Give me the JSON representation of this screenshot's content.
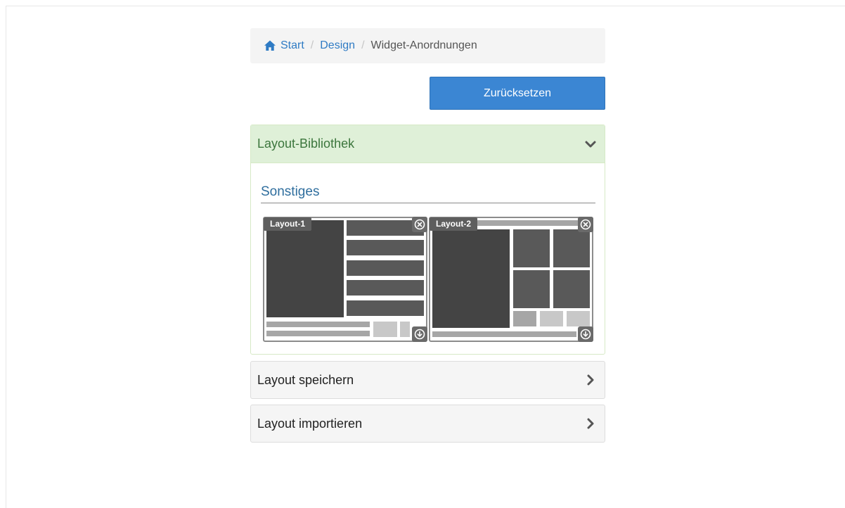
{
  "breadcrumb": {
    "items": [
      {
        "label": "Start",
        "icon": "home-icon",
        "link": true
      },
      {
        "label": "Design",
        "link": true
      },
      {
        "label": "Widget-Anordnungen",
        "link": false
      }
    ],
    "separator": "/"
  },
  "toolbar": {
    "reset_label": "Zurücksetzen"
  },
  "library": {
    "title": "Layout-Bibliothek",
    "section_title": "Sonstiges",
    "layouts": [
      {
        "label": "Layout-1"
      },
      {
        "label": "Layout-2"
      }
    ]
  },
  "panels": {
    "save_label": "Layout speichern",
    "import_label": "Layout importieren"
  },
  "colors": {
    "accent": "#3b86d3",
    "link": "#2f7bc4",
    "success_bg": "#dff0d8",
    "success_text": "#3c763d"
  }
}
